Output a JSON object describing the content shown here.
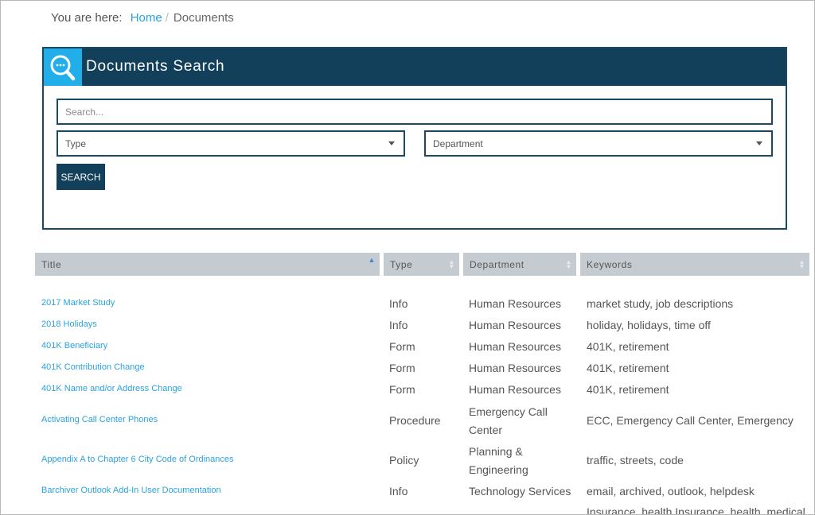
{
  "breadcrumb": {
    "prefix": "You are here:",
    "home": "Home",
    "separator": "/",
    "current": "Documents"
  },
  "search_panel": {
    "title": "Documents Search",
    "search_placeholder": "Search...",
    "type_select": "Type",
    "department_select": "Department",
    "search_button": "SEARCH"
  },
  "table": {
    "columns": [
      "Title",
      "Type",
      "Department",
      "Keywords"
    ],
    "rows": [
      {
        "title": "2017 Market Study",
        "type": "Info",
        "department": "Human Resources",
        "keywords": "market study, job descriptions"
      },
      {
        "title": "2018 Holidays",
        "type": "Info",
        "department": "Human Resources",
        "keywords": "holiday, holidays, time off"
      },
      {
        "title": "401K Beneficiary",
        "type": "Form",
        "department": "Human Resources",
        "keywords": "401K, retirement"
      },
      {
        "title": "401K Contribution Change",
        "type": "Form",
        "department": "Human Resources",
        "keywords": "401K, retirement"
      },
      {
        "title": "401K Name and/or Address Change",
        "type": "Form",
        "department": "Human Resources",
        "keywords": "401K, retirement"
      },
      {
        "title": "Activating Call Center Phones",
        "type": "Procedure",
        "department": "Emergency Call Center",
        "keywords": "ECC, Emergency Call Center, Emergency"
      },
      {
        "title": "Appendix A to Chapter 6 City Code of Ordinances",
        "type": "Policy",
        "department": "Planning & Engineering",
        "keywords": "traffic, streets, code"
      },
      {
        "title": "Barchiver Outlook Add-In User Documentation",
        "type": "Info",
        "department": "Technology Services",
        "keywords": "email, archived, outlook, helpdesk"
      },
      {
        "title": "",
        "type": "",
        "department": "",
        "keywords": "Insurance, health Insurance, health, medical"
      }
    ]
  },
  "colors": {
    "accent_dark": "#12405a",
    "accent_light": "#22aee8",
    "link": "#2aa3de",
    "header_bg": "#c5ccd1"
  },
  "icons": {
    "search": "magnifier-with-dots-icon",
    "sort": "sort-arrows-icon",
    "dropdown": "caret-down-icon"
  }
}
